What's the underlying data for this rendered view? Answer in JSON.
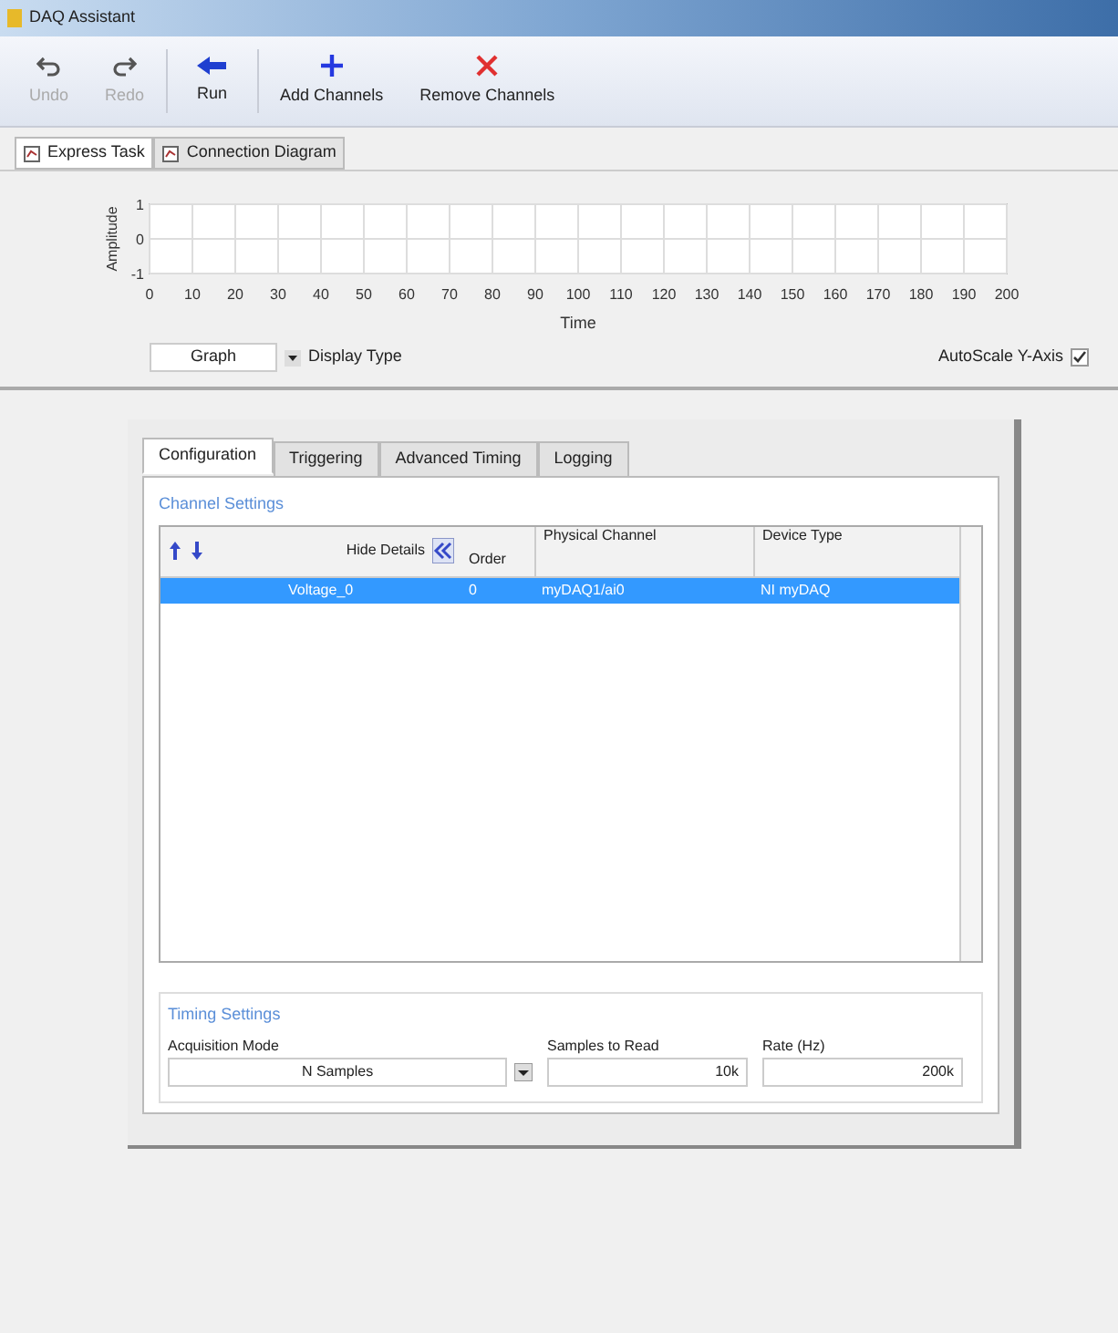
{
  "window": {
    "title": "DAQ Assistant"
  },
  "toolbar": [
    {
      "label": "Undo",
      "kind": "undo",
      "disabled": true
    },
    {
      "label": "Redo",
      "kind": "redo",
      "disabled": true
    },
    {
      "label": "Run",
      "kind": "run",
      "disabled": false
    },
    {
      "label": "Add Channels",
      "kind": "add",
      "disabled": false
    },
    {
      "label": "Remove Channels",
      "kind": "remove",
      "disabled": false
    }
  ],
  "view_tabs": [
    {
      "label": "Express Task",
      "selected": true
    },
    {
      "label": "Connection Diagram",
      "selected": false
    }
  ],
  "graph": {
    "chart_data": {
      "type": "line",
      "xlabel": "Time",
      "ylabel": "Amplitude",
      "xlim": [
        0,
        200
      ],
      "ylim": [
        -1,
        1
      ],
      "xticks": [
        0,
        10,
        20,
        30,
        40,
        50,
        60,
        70,
        80,
        90,
        100,
        110,
        120,
        130,
        140,
        150,
        160,
        170,
        180,
        190,
        200
      ],
      "yticks": [
        -1,
        0,
        1
      ],
      "grid": true
    },
    "display_type_value": "Graph",
    "display_type_label": "Display Type",
    "autoscale_label": "AutoScale Y-Axis",
    "autoscale_checked": true
  },
  "config_tabs": [
    {
      "label": "Configuration",
      "selected": true
    },
    {
      "label": "Triggering",
      "selected": false
    },
    {
      "label": "Advanced Timing",
      "selected": false
    },
    {
      "label": "Logging",
      "selected": false
    }
  ],
  "channel_settings": {
    "title": "Channel Settings",
    "hide_details": "Hide Details",
    "columns": [
      "Order",
      "Physical Channel",
      "Device Type"
    ],
    "rows": [
      {
        "name": "Voltage_0",
        "order": "0",
        "physical_channel": "myDAQ1/ai0",
        "device_type": "NI myDAQ",
        "selected": true
      }
    ]
  },
  "timing_settings": {
    "title": "Timing Settings",
    "acquisition_mode_label": "Acquisition Mode",
    "acquisition_mode": "N Samples",
    "samples_label": "Samples to Read",
    "samples": "10k",
    "rate_label": "Rate (Hz)",
    "rate": "200k"
  }
}
